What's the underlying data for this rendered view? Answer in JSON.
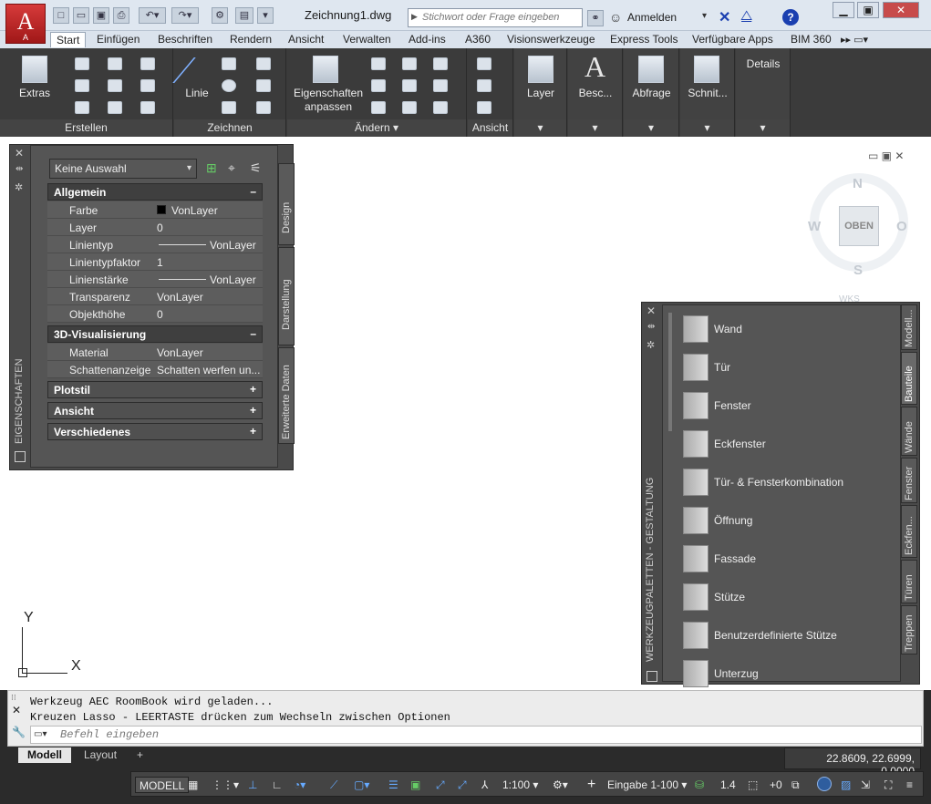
{
  "app": {
    "logo_letter": "A",
    "logo_sub": "A",
    "doc_title": "Zeichnung1.dwg",
    "search_placeholder": "Stichwort oder Frage eingeben",
    "login": "Anmelden"
  },
  "tabs": [
    "Start",
    "Einfügen",
    "Beschriften",
    "Rendern",
    "Ansicht",
    "Verwalten",
    "Add-ins",
    "A360",
    "Visionswerkzeuge",
    "Express Tools",
    "Verfügbare Apps",
    "BIM 360"
  ],
  "ribbon": {
    "extras": "Extras",
    "erstellen": "Erstellen",
    "linie": "Linie",
    "zeichnen": "Zeichnen",
    "eig1": "Eigenschaften",
    "eig2": "anpassen",
    "aendern": "Ändern",
    "ansicht": "Ansicht",
    "layer": "Layer",
    "besc": "Besc...",
    "abfrage": "Abfrage",
    "schnit": "Schnit...",
    "details": "Details",
    "a_letter": "A"
  },
  "props": {
    "selection": "Keine Auswahl",
    "title": "EIGENSCHAFTEN",
    "tabs": [
      "Design",
      "Darstellung",
      "Erweiterte Daten"
    ],
    "groups": {
      "allgemein": "Allgemein",
      "viz": "3D-Visualisierung",
      "plotstil": "Plotstil",
      "ansicht": "Ansicht",
      "versch": "Verschiedenes"
    },
    "rows": [
      {
        "k": "Farbe",
        "v": "VonLayer"
      },
      {
        "k": "Layer",
        "v": "0"
      },
      {
        "k": "Linientyp",
        "v": "VonLayer"
      },
      {
        "k": "Linientypfaktor",
        "v": "1"
      },
      {
        "k": "Linienstärke",
        "v": "VonLayer"
      },
      {
        "k": "Transparenz",
        "v": "VonLayer"
      },
      {
        "k": "Objekthöhe",
        "v": "0"
      }
    ],
    "rows3d": [
      {
        "k": "Material",
        "v": "VonLayer"
      },
      {
        "k": "Schattenanzeige",
        "v": "Schatten werfen un..."
      }
    ],
    "minus": "–",
    "plus": "+"
  },
  "compass": {
    "n": "N",
    "w": "W",
    "o": "O",
    "s": "S",
    "center": "OBEN",
    "wks": "WKS"
  },
  "tools": {
    "title": "WERKZEUGPALETTEN - GESTALTUNG",
    "items": [
      "Wand",
      "Tür",
      "Fenster",
      "Eckfenster",
      "Tür- & Fensterkombination",
      "Öffnung",
      "Fassade",
      "Stütze",
      "Benutzerdefinierte Stütze",
      "Unterzug"
    ],
    "tabs": [
      "Modell...",
      "Bauteile",
      "Wände",
      "Fenster",
      "Eckfen...",
      "Türen",
      "Treppen"
    ]
  },
  "ucs": {
    "x": "X",
    "y": "Y"
  },
  "cmd": {
    "line1": "Werkzeug AEC RoomBook wird geladen...",
    "line2": "Kreuzen Lasso - LEERTASTE drücken zum Wechseln zwischen Optionen",
    "placeholder": "Befehl eingeben"
  },
  "layout": {
    "model": "Modell",
    "layout": "Layout",
    "add": "+"
  },
  "status": {
    "coords": "22.8609, 22.6999, 0.0000",
    "model": "MODELL",
    "scale": "1:100",
    "units": "Eingabe 1-100",
    "lw": "1.4",
    "plus": "+0"
  }
}
